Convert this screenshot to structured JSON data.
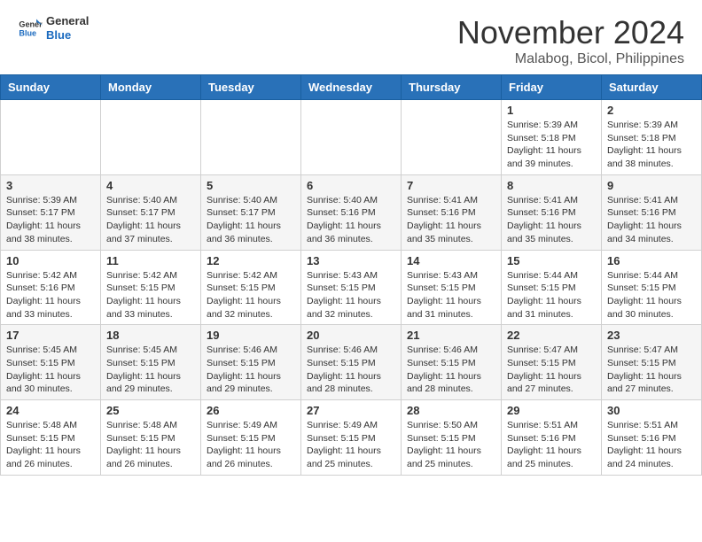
{
  "header": {
    "logo_general": "General",
    "logo_blue": "Blue",
    "month_title": "November 2024",
    "location": "Malabog, Bicol, Philippines"
  },
  "weekdays": [
    "Sunday",
    "Monday",
    "Tuesday",
    "Wednesday",
    "Thursday",
    "Friday",
    "Saturday"
  ],
  "weeks": [
    [
      {
        "day": "",
        "info": ""
      },
      {
        "day": "",
        "info": ""
      },
      {
        "day": "",
        "info": ""
      },
      {
        "day": "",
        "info": ""
      },
      {
        "day": "",
        "info": ""
      },
      {
        "day": "1",
        "info": "Sunrise: 5:39 AM\nSunset: 5:18 PM\nDaylight: 11 hours\nand 39 minutes."
      },
      {
        "day": "2",
        "info": "Sunrise: 5:39 AM\nSunset: 5:18 PM\nDaylight: 11 hours\nand 38 minutes."
      }
    ],
    [
      {
        "day": "3",
        "info": "Sunrise: 5:39 AM\nSunset: 5:17 PM\nDaylight: 11 hours\nand 38 minutes."
      },
      {
        "day": "4",
        "info": "Sunrise: 5:40 AM\nSunset: 5:17 PM\nDaylight: 11 hours\nand 37 minutes."
      },
      {
        "day": "5",
        "info": "Sunrise: 5:40 AM\nSunset: 5:17 PM\nDaylight: 11 hours\nand 36 minutes."
      },
      {
        "day": "6",
        "info": "Sunrise: 5:40 AM\nSunset: 5:16 PM\nDaylight: 11 hours\nand 36 minutes."
      },
      {
        "day": "7",
        "info": "Sunrise: 5:41 AM\nSunset: 5:16 PM\nDaylight: 11 hours\nand 35 minutes."
      },
      {
        "day": "8",
        "info": "Sunrise: 5:41 AM\nSunset: 5:16 PM\nDaylight: 11 hours\nand 35 minutes."
      },
      {
        "day": "9",
        "info": "Sunrise: 5:41 AM\nSunset: 5:16 PM\nDaylight: 11 hours\nand 34 minutes."
      }
    ],
    [
      {
        "day": "10",
        "info": "Sunrise: 5:42 AM\nSunset: 5:16 PM\nDaylight: 11 hours\nand 33 minutes."
      },
      {
        "day": "11",
        "info": "Sunrise: 5:42 AM\nSunset: 5:15 PM\nDaylight: 11 hours\nand 33 minutes."
      },
      {
        "day": "12",
        "info": "Sunrise: 5:42 AM\nSunset: 5:15 PM\nDaylight: 11 hours\nand 32 minutes."
      },
      {
        "day": "13",
        "info": "Sunrise: 5:43 AM\nSunset: 5:15 PM\nDaylight: 11 hours\nand 32 minutes."
      },
      {
        "day": "14",
        "info": "Sunrise: 5:43 AM\nSunset: 5:15 PM\nDaylight: 11 hours\nand 31 minutes."
      },
      {
        "day": "15",
        "info": "Sunrise: 5:44 AM\nSunset: 5:15 PM\nDaylight: 11 hours\nand 31 minutes."
      },
      {
        "day": "16",
        "info": "Sunrise: 5:44 AM\nSunset: 5:15 PM\nDaylight: 11 hours\nand 30 minutes."
      }
    ],
    [
      {
        "day": "17",
        "info": "Sunrise: 5:45 AM\nSunset: 5:15 PM\nDaylight: 11 hours\nand 30 minutes."
      },
      {
        "day": "18",
        "info": "Sunrise: 5:45 AM\nSunset: 5:15 PM\nDaylight: 11 hours\nand 29 minutes."
      },
      {
        "day": "19",
        "info": "Sunrise: 5:46 AM\nSunset: 5:15 PM\nDaylight: 11 hours\nand 29 minutes."
      },
      {
        "day": "20",
        "info": "Sunrise: 5:46 AM\nSunset: 5:15 PM\nDaylight: 11 hours\nand 28 minutes."
      },
      {
        "day": "21",
        "info": "Sunrise: 5:46 AM\nSunset: 5:15 PM\nDaylight: 11 hours\nand 28 minutes."
      },
      {
        "day": "22",
        "info": "Sunrise: 5:47 AM\nSunset: 5:15 PM\nDaylight: 11 hours\nand 27 minutes."
      },
      {
        "day": "23",
        "info": "Sunrise: 5:47 AM\nSunset: 5:15 PM\nDaylight: 11 hours\nand 27 minutes."
      }
    ],
    [
      {
        "day": "24",
        "info": "Sunrise: 5:48 AM\nSunset: 5:15 PM\nDaylight: 11 hours\nand 26 minutes."
      },
      {
        "day": "25",
        "info": "Sunrise: 5:48 AM\nSunset: 5:15 PM\nDaylight: 11 hours\nand 26 minutes."
      },
      {
        "day": "26",
        "info": "Sunrise: 5:49 AM\nSunset: 5:15 PM\nDaylight: 11 hours\nand 26 minutes."
      },
      {
        "day": "27",
        "info": "Sunrise: 5:49 AM\nSunset: 5:15 PM\nDaylight: 11 hours\nand 25 minutes."
      },
      {
        "day": "28",
        "info": "Sunrise: 5:50 AM\nSunset: 5:15 PM\nDaylight: 11 hours\nand 25 minutes."
      },
      {
        "day": "29",
        "info": "Sunrise: 5:51 AM\nSunset: 5:16 PM\nDaylight: 11 hours\nand 25 minutes."
      },
      {
        "day": "30",
        "info": "Sunrise: 5:51 AM\nSunset: 5:16 PM\nDaylight: 11 hours\nand 24 minutes."
      }
    ]
  ]
}
